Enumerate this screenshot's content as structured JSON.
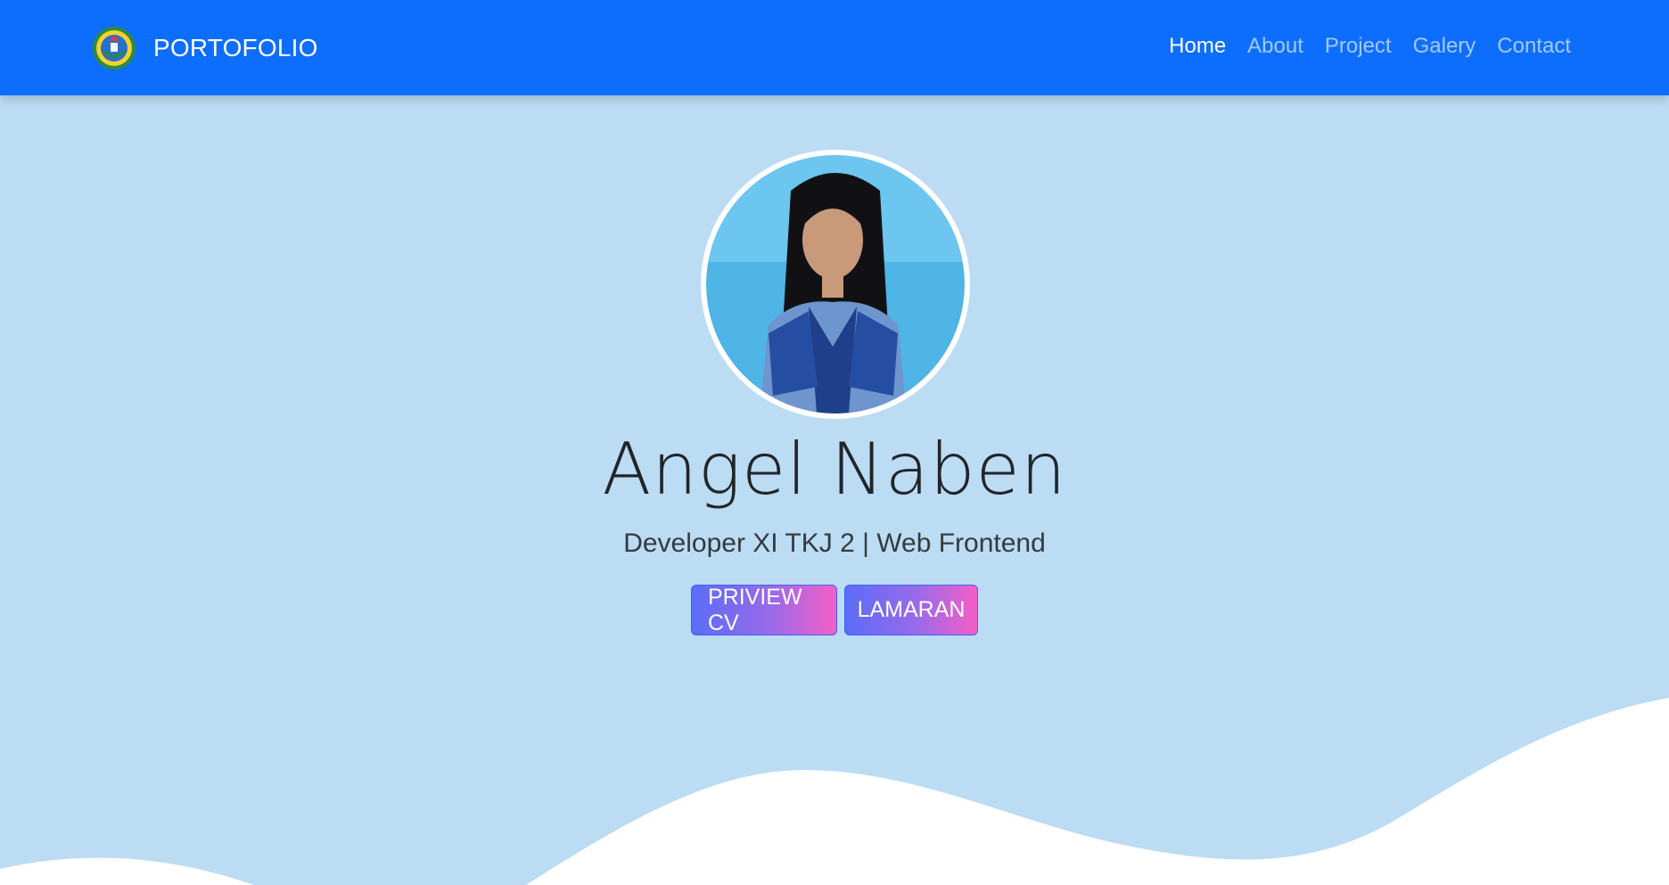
{
  "navbar": {
    "brand_icon": "school-logo-icon",
    "brand": "PORTOFOLIO",
    "links": [
      {
        "label": "Home",
        "active": true
      },
      {
        "label": "About",
        "active": false
      },
      {
        "label": "Project",
        "active": false
      },
      {
        "label": "Galery",
        "active": false
      },
      {
        "label": "Contact",
        "active": false
      }
    ]
  },
  "hero": {
    "name": "Angel Naben",
    "subtitle": "Developer XI TKJ 2 | Web Frontend",
    "buttons": {
      "cv": "PRIVIEW CV",
      "lamaran": "LAMARAN"
    }
  },
  "colors": {
    "navbar": "#0d6efd",
    "background": "#bbdcf3",
    "wave": "#ffffff",
    "button_gradient_start": "#5b6cf8",
    "button_gradient_end": "#f55fc7"
  }
}
